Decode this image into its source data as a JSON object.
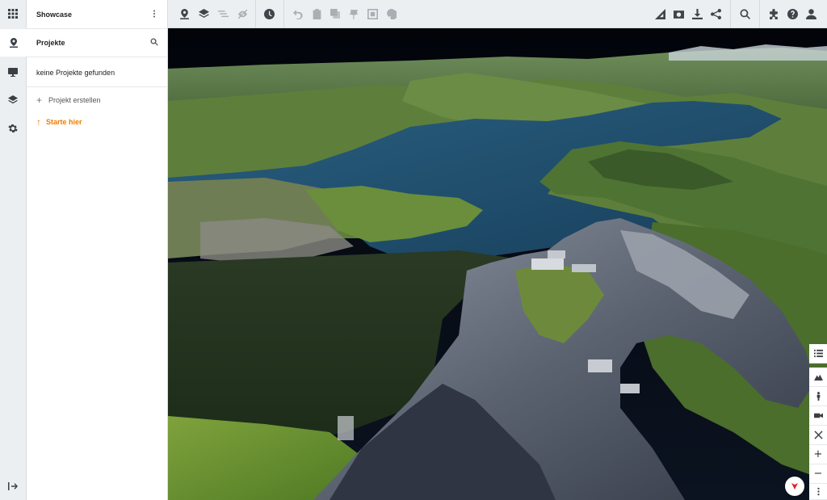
{
  "panel": {
    "title": "Showcase",
    "section_title": "Projekte",
    "empty_text": "keine Projekte gefunden",
    "create_label": "Projekt erstellen",
    "start_label": "Starte hier"
  },
  "rail": {
    "items": [
      "apps-grid-icon",
      "map-pin-icon",
      "presentation-icon",
      "layers-icon",
      "gear-icon",
      "collapse-sidebar-icon"
    ]
  },
  "toolbar": {
    "left_icons": [
      "map-pin-icon",
      "layers-icon",
      "list-icon",
      "hide-icon",
      "clock-icon",
      "undo-icon",
      "paste-icon",
      "copy-icon",
      "pin-icon",
      "select-icon",
      "paint-icon"
    ],
    "right_icons": [
      "measure-icon",
      "screenshot-icon",
      "download-icon",
      "share-icon",
      "search-icon",
      "puzzle-icon",
      "help-icon",
      "user-icon"
    ]
  },
  "map_controls": [
    "list-icon",
    "terrain-icon",
    "person-icon",
    "camera-icon",
    "fullscreen-icon",
    "zoom-in",
    "zoom-out",
    "more-icon"
  ],
  "colors": {
    "accent": "#f07c00",
    "panel_bg": "#ffffff",
    "rail_bg": "#eceff2",
    "lake": "#1f4e6e",
    "sky": "#05070d"
  }
}
